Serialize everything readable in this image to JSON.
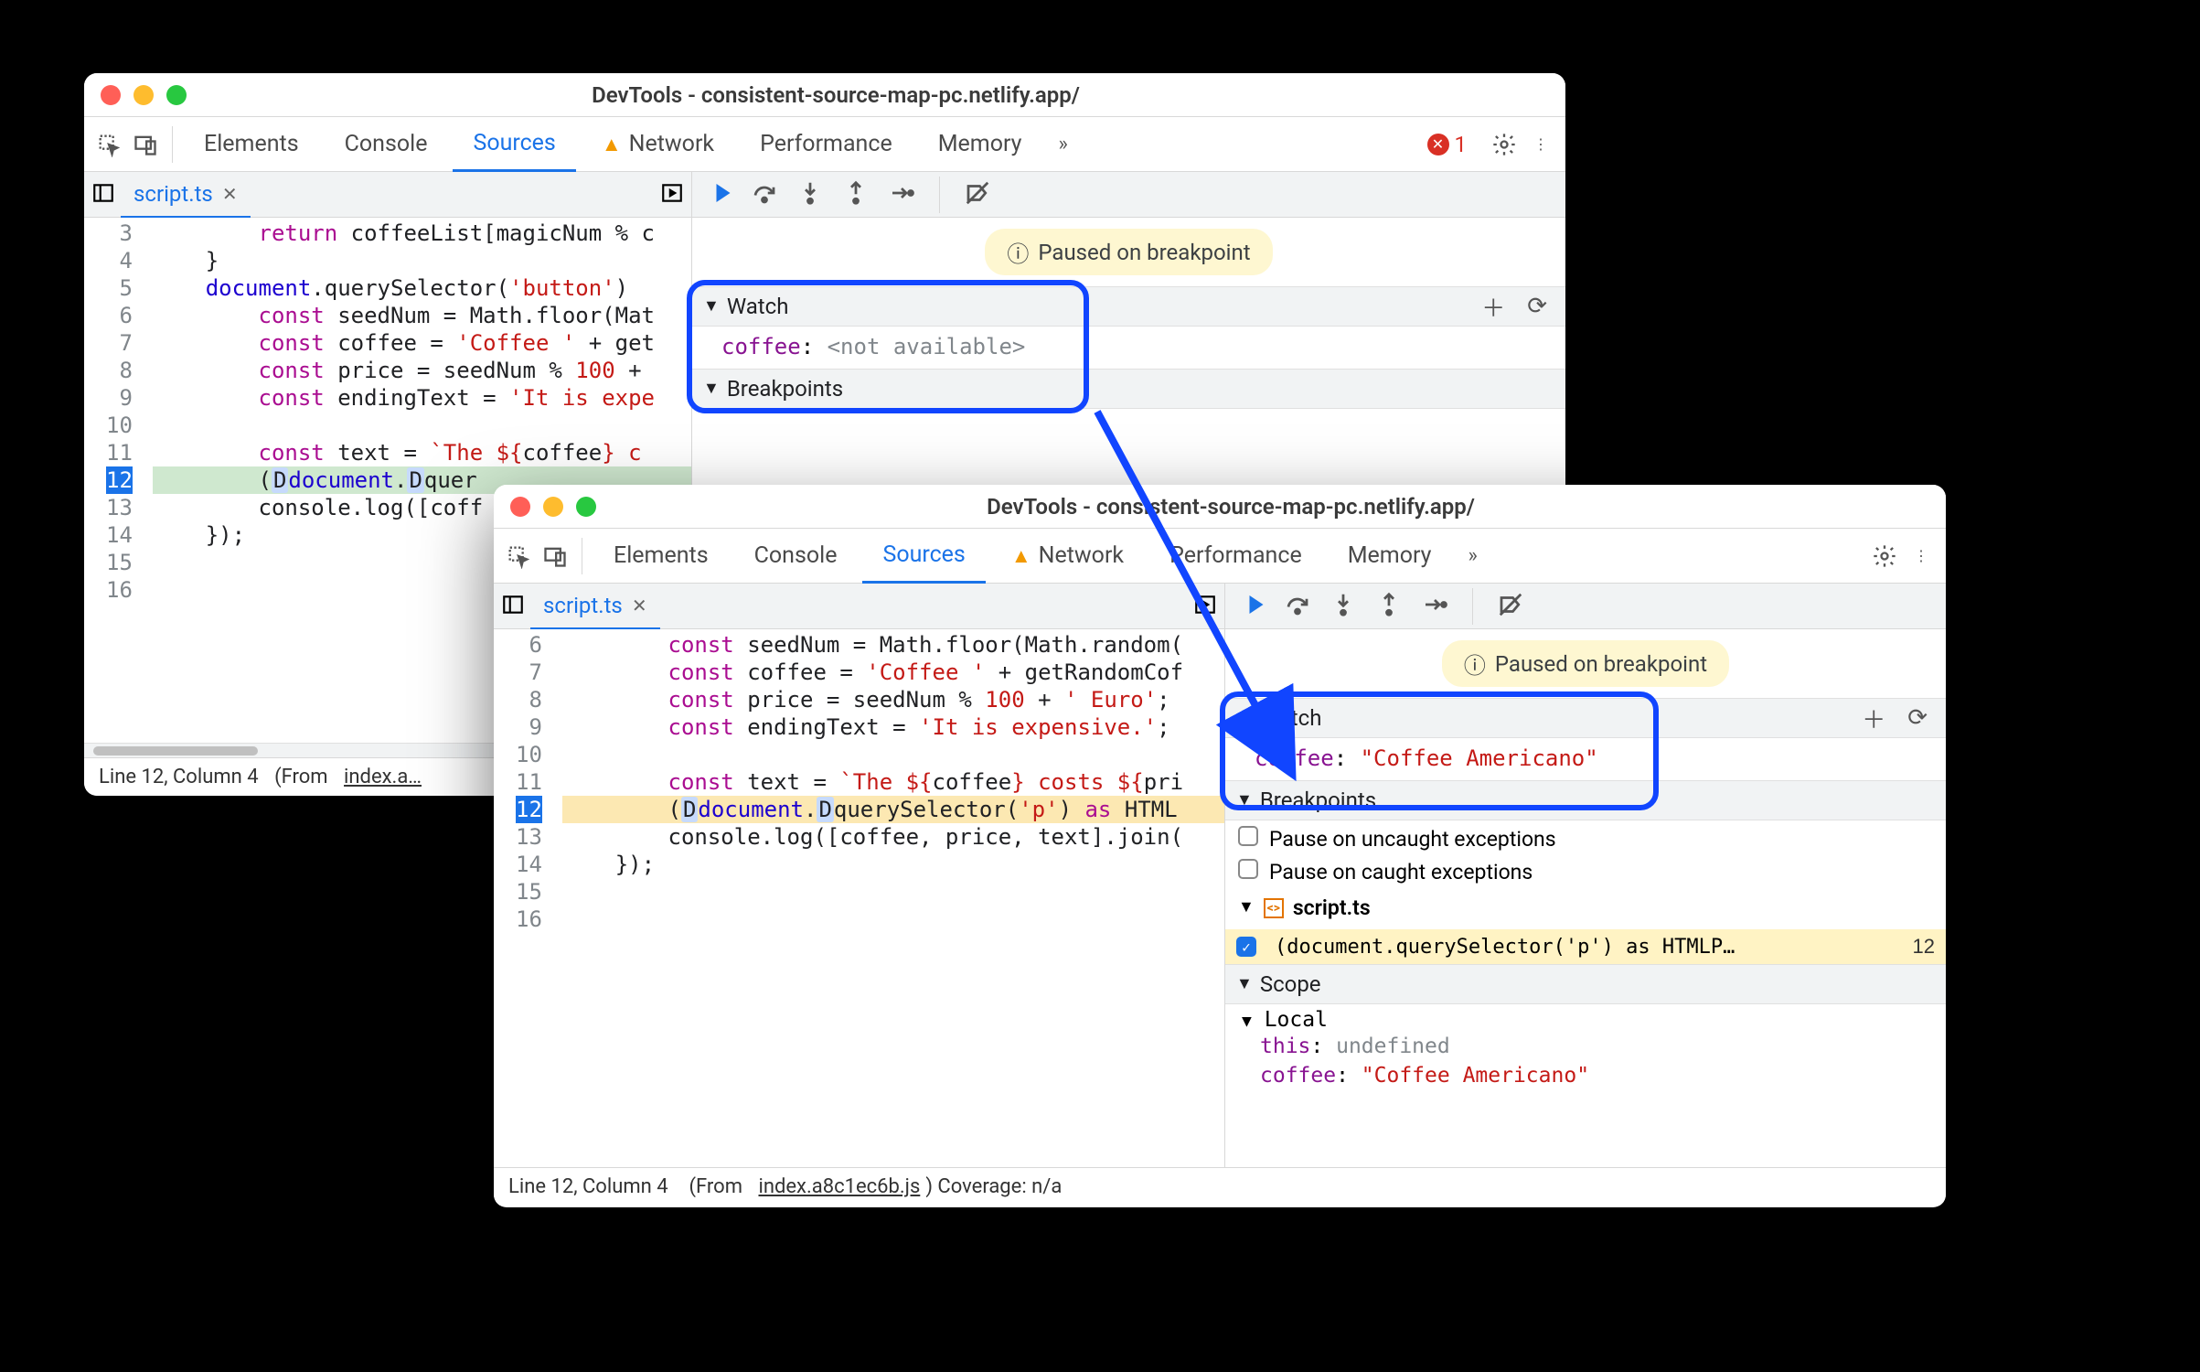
{
  "title": "DevTools - consistent-source-map-pc.netlify.app/",
  "tabs": [
    "Elements",
    "Console",
    "Sources",
    "Network",
    "Performance",
    "Memory"
  ],
  "active_tab": "Sources",
  "error_count": "1",
  "file_tab": "script.ts",
  "paused_msg": "Paused on breakpoint",
  "watch_label": "Watch",
  "breakpoints_label": "Breakpoints",
  "scope_label": "Scope",
  "local_label": "Local",
  "watch1": {
    "key": "coffee",
    "value": "<not available>"
  },
  "watch2": {
    "key": "coffee",
    "value": "\"Coffee Americano\""
  },
  "pause_uncaught": "Pause on uncaught exceptions",
  "pause_caught": "Pause on caught exceptions",
  "bp_file": "script.ts",
  "bp_item_text": "(document.querySelector('p') as HTMLP…",
  "bp_item_line": "12",
  "scope_this_key": "this",
  "scope_this_val": "undefined",
  "scope_coffee_key": "coffee",
  "scope_coffee_val": "\"Coffee Americano\"",
  "status1_a": "Line 12, Column 4",
  "status1_b": "(From",
  "status1_c": "index.a…",
  "status2_a": "Line 12, Column 4",
  "status2_b": "(From",
  "status2_c": "index.a8c1ec6b.js",
  "status2_d": ") Coverage: n/a",
  "win1_lines": {
    "start": 3,
    "highlight": 12,
    "code": [
      {
        "n": 3,
        "pre": "        ",
        "html": "<span class='kw'>return</span> coffeeList[magicNum % c"
      },
      {
        "n": 4,
        "pre": "    ",
        "html": "}"
      },
      {
        "n": 5,
        "pre": "    ",
        "html": "<span class='prop'>document</span>.querySelector(<span class='str'>'button'</span>)"
      },
      {
        "n": 6,
        "pre": "        ",
        "html": "<span class='kw'>const</span> seedNum = Math.floor(Mat"
      },
      {
        "n": 7,
        "pre": "        ",
        "html": "<span class='kw'>const</span> coffee = <span class='str'>'Coffee '</span> + get"
      },
      {
        "n": 8,
        "pre": "        ",
        "html": "<span class='kw'>const</span> price = seedNum % <span class='num'>100</span> + "
      },
      {
        "n": 9,
        "pre": "        ",
        "html": "<span class='kw'>const</span> endingText = <span class='str'>'It is expe"
      },
      {
        "n": 10,
        "pre": "",
        "html": ""
      },
      {
        "n": 11,
        "pre": "        ",
        "html": "<span class='kw'>const</span> text = <span class='str'>`The ${</span>coffee<span class='str'>} c</span>"
      },
      {
        "n": 12,
        "pre": "        ",
        "html": "(<span class='objchip'>D</span><span class='prop'>document</span>.<span class='objchip'>D</span>quer",
        "exec": true
      },
      {
        "n": 13,
        "pre": "        ",
        "html": "console.log([coff"
      },
      {
        "n": 14,
        "pre": "    ",
        "html": "});"
      },
      {
        "n": 15,
        "pre": "",
        "html": ""
      },
      {
        "n": 16,
        "pre": "",
        "html": ""
      }
    ]
  },
  "win2_lines": {
    "start": 6,
    "highlight": 12,
    "code": [
      {
        "n": 6,
        "pre": "        ",
        "html": "<span class='kw'>const</span> seedNum = Math.floor(Math.random("
      },
      {
        "n": 7,
        "pre": "        ",
        "html": "<span class='kw'>const</span> coffee = <span class='str'>'Coffee '</span> + getRandomCof"
      },
      {
        "n": 8,
        "pre": "        ",
        "html": "<span class='kw'>const</span> price = seedNum % <span class='num'>100</span> + <span class='str'>' Euro'</span>;"
      },
      {
        "n": 9,
        "pre": "        ",
        "html": "<span class='kw'>const</span> endingText = <span class='str'>'It is expensive.'</span>;"
      },
      {
        "n": 10,
        "pre": "",
        "html": ""
      },
      {
        "n": 11,
        "pre": "        ",
        "html": "<span class='kw'>const</span> text = <span class='str'>`The ${</span>coffee<span class='str'>} costs ${</span>pri"
      },
      {
        "n": 12,
        "pre": "        ",
        "html": "(<span class='objchip'>D</span><span class='prop'>document</span>.<span class='objchip'>D</span>querySelector(<span class='str'>'p'</span>) <span class='kw'>as</span> HTML",
        "exec": true
      },
      {
        "n": 13,
        "pre": "        ",
        "html": "console.log([coffee, price, text].join("
      },
      {
        "n": 14,
        "pre": "    ",
        "html": "});"
      },
      {
        "n": 15,
        "pre": "",
        "html": ""
      },
      {
        "n": 16,
        "pre": "",
        "html": ""
      }
    ]
  }
}
